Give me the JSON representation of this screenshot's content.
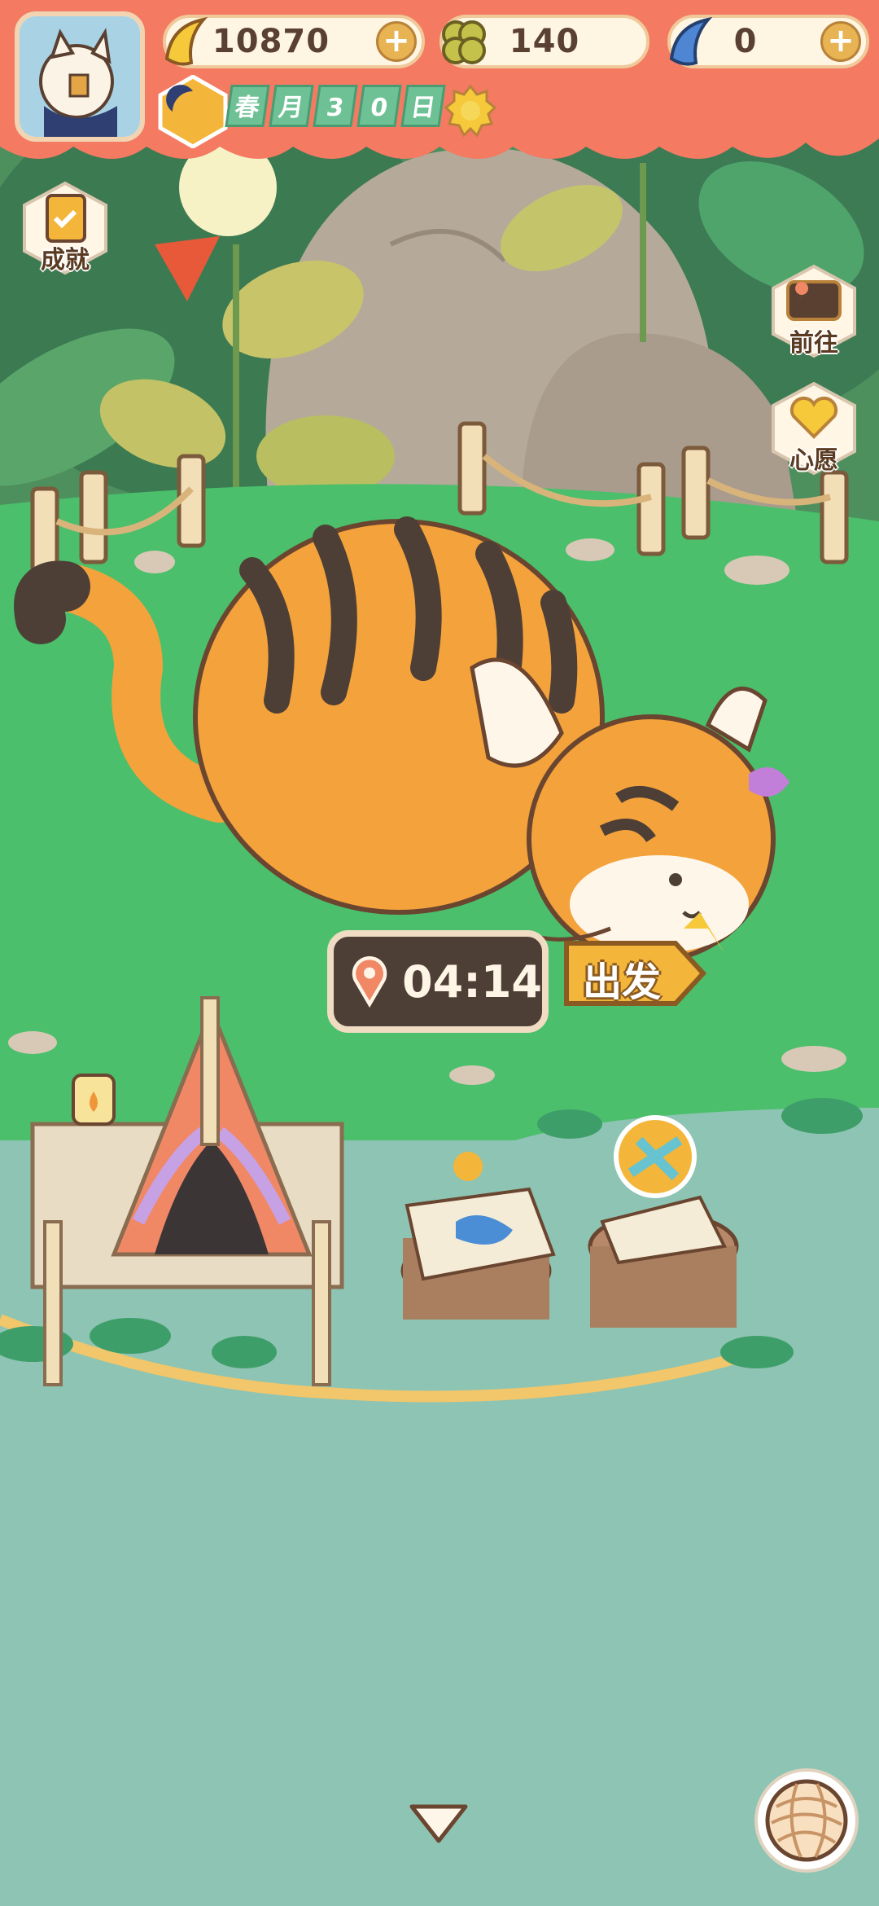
{
  "hud": {
    "bananas": "10870",
    "clovers": "140",
    "blue_bananas": "0",
    "plus_label": "+",
    "season": "春",
    "month_label": "月",
    "day_digit_1": "3",
    "day_digit_2": "0",
    "day_label": "日",
    "weather_icon": "sun-icon"
  },
  "side_buttons": {
    "achievements": "成就",
    "goto": "前往",
    "wish": "心愿"
  },
  "expedition": {
    "timer": "04:14",
    "depart": "出发"
  },
  "colors": {
    "grass": "#4bbf6b",
    "water": "#8ec4b3",
    "header_red": "#f47a62",
    "tiger_orange": "#f4a23c",
    "stripe_dark": "#4d3f36"
  }
}
